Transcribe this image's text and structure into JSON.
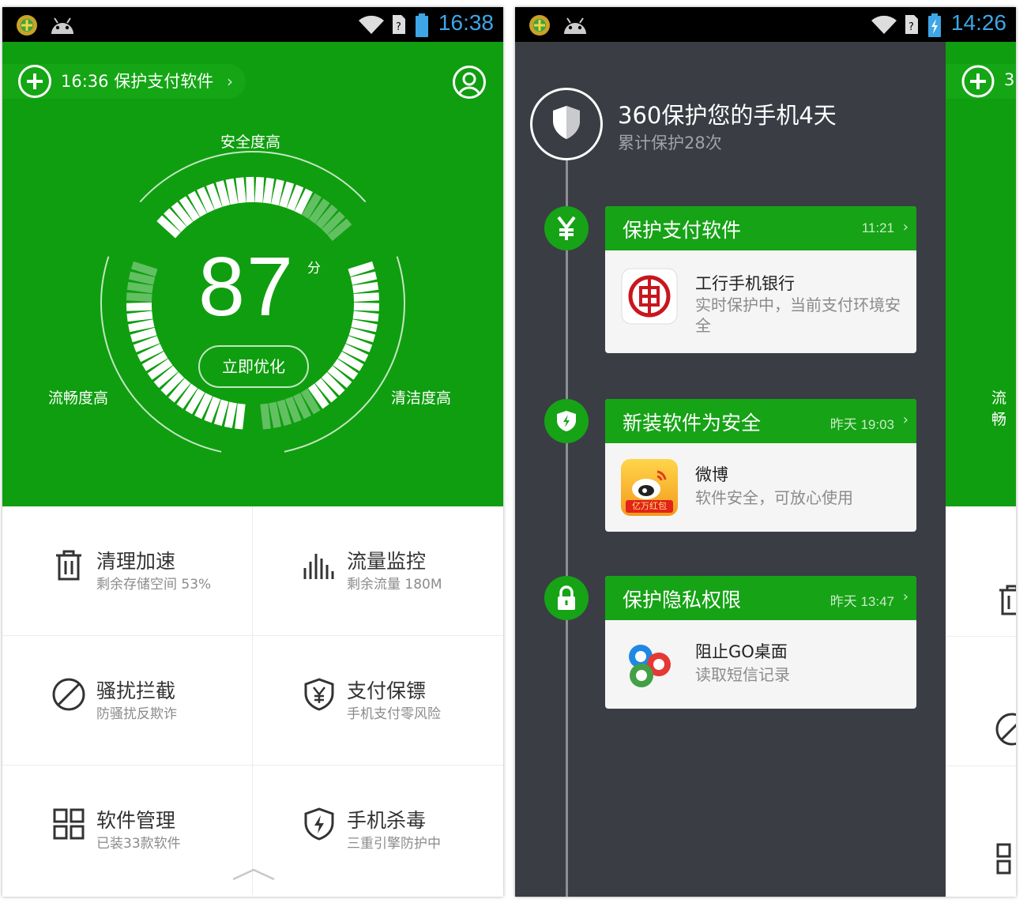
{
  "left": {
    "status": {
      "time": "16:38"
    },
    "notice": {
      "text": "16:36 保护支付软件",
      "chevron": "›"
    },
    "gauge": {
      "top_label": "安全度高",
      "left_label": "流畅度高",
      "right_label": "清洁度高",
      "score": "87",
      "score_unit": "分",
      "action": "立即优化"
    },
    "tiles": [
      {
        "title": "清理加速",
        "subtitle": "剩余存储空间 53%",
        "icon": "trash-icon"
      },
      {
        "title": "流量监控",
        "subtitle": "剩余流量 180M",
        "icon": "bars-icon"
      },
      {
        "title": "骚扰拦截",
        "subtitle": "防骚扰反欺诈",
        "icon": "block-icon"
      },
      {
        "title": "支付保镖",
        "subtitle": "手机支付零风险",
        "icon": "yen-shield-icon"
      },
      {
        "title": "软件管理",
        "subtitle": "已装33款软件",
        "icon": "grid-icon"
      },
      {
        "title": "手机杀毒",
        "subtitle": "三重引擎防护中",
        "icon": "bolt-shield-icon"
      }
    ]
  },
  "right": {
    "status": {
      "time": "14:26"
    },
    "header": {
      "title": "360保护您的手机4天",
      "subtitle": "累计保护28次"
    },
    "cards": [
      {
        "title": "保护支付软件",
        "time": "11:21",
        "app_name": "工行手机银行",
        "desc": "实时保护中，当前支付环境安全"
      },
      {
        "title": "新装软件为安全",
        "time": "昨天 19:03",
        "app_name": "微博",
        "desc": "软件安全，可放心使用",
        "app_badge": "亿万红包"
      },
      {
        "title": "保护隐私权限",
        "time": "昨天 13:47",
        "app_name": "阻止GO桌面",
        "desc": "读取短信记录"
      }
    ],
    "peek": {
      "notice": "3",
      "label": "流畅"
    }
  },
  "colors": {
    "green": "#0f9e0f",
    "card_green": "#16a316",
    "drawer": "#3a3d44",
    "clock_blue": "#3ea6e6"
  }
}
